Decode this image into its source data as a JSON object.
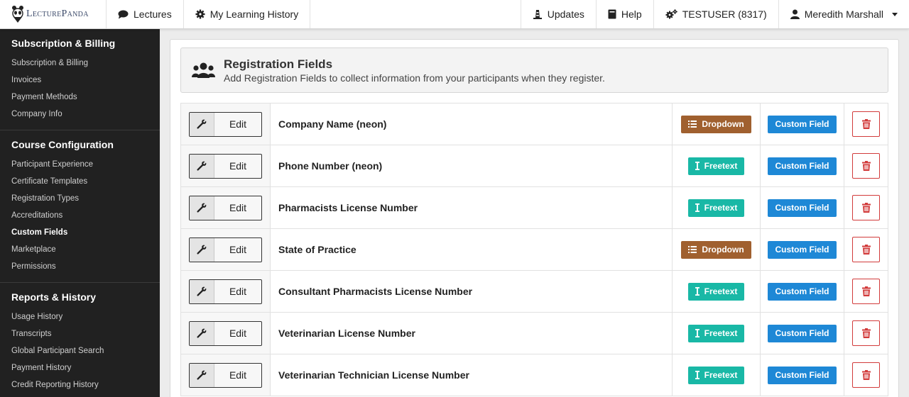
{
  "brand": {
    "name": "LecturePanda"
  },
  "nav": {
    "left": [
      {
        "label": "Lectures",
        "icon": "comment-icon"
      },
      {
        "label": "My Learning History",
        "icon": "gear-icon"
      }
    ],
    "right": [
      {
        "label": "Updates",
        "icon": "lighthouse-icon"
      },
      {
        "label": "Help",
        "icon": "book-icon"
      },
      {
        "label": "TESTUSER (8317)",
        "icon": "cogs-icon"
      }
    ],
    "user": {
      "label": "Meredith Marshall",
      "icon": "user-icon"
    }
  },
  "sidebar": {
    "sections": [
      {
        "title": "Subscription & Billing",
        "items": [
          {
            "label": "Subscription & Billing",
            "active": false
          },
          {
            "label": "Invoices",
            "active": false
          },
          {
            "label": "Payment Methods",
            "active": false
          },
          {
            "label": "Company Info",
            "active": false
          }
        ]
      },
      {
        "title": "Course Configuration",
        "items": [
          {
            "label": "Participant Experience",
            "active": false
          },
          {
            "label": "Certificate Templates",
            "active": false
          },
          {
            "label": "Registration Types",
            "active": false
          },
          {
            "label": "Accreditations",
            "active": false
          },
          {
            "label": "Custom Fields",
            "active": true
          },
          {
            "label": "Marketplace",
            "active": false
          },
          {
            "label": "Permissions",
            "active": false
          }
        ]
      },
      {
        "title": "Reports & History",
        "items": [
          {
            "label": "Usage History",
            "active": false
          },
          {
            "label": "Transcripts",
            "active": false
          },
          {
            "label": "Global Participant Search",
            "active": false
          },
          {
            "label": "Payment History",
            "active": false
          },
          {
            "label": "Credit Reporting History",
            "active": false
          }
        ]
      }
    ]
  },
  "header": {
    "title": "Registration Fields",
    "subtitle": "Add Registration Fields to collect information from your participants when they register."
  },
  "colors": {
    "dropdown": "#a0602f",
    "freetext": "#19b8a6",
    "custom_field": "#1e88d6",
    "delete": "#d23b3b"
  },
  "fields": [
    {
      "edit_label": "Edit",
      "name": "Company Name (neon)",
      "type": "Dropdown",
      "source": "Custom Field"
    },
    {
      "edit_label": "Edit",
      "name": "Phone Number (neon)",
      "type": "Freetext",
      "source": "Custom Field"
    },
    {
      "edit_label": "Edit",
      "name": "Pharmacists License Number",
      "type": "Freetext",
      "source": "Custom Field"
    },
    {
      "edit_label": "Edit",
      "name": "State of Practice",
      "type": "Dropdown",
      "source": "Custom Field"
    },
    {
      "edit_label": "Edit",
      "name": "Consultant Pharmacists License Number",
      "type": "Freetext",
      "source": "Custom Field"
    },
    {
      "edit_label": "Edit",
      "name": "Veterinarian License Number",
      "type": "Freetext",
      "source": "Custom Field"
    },
    {
      "edit_label": "Edit",
      "name": "Veterinarian Technician License Number",
      "type": "Freetext",
      "source": "Custom Field"
    }
  ]
}
